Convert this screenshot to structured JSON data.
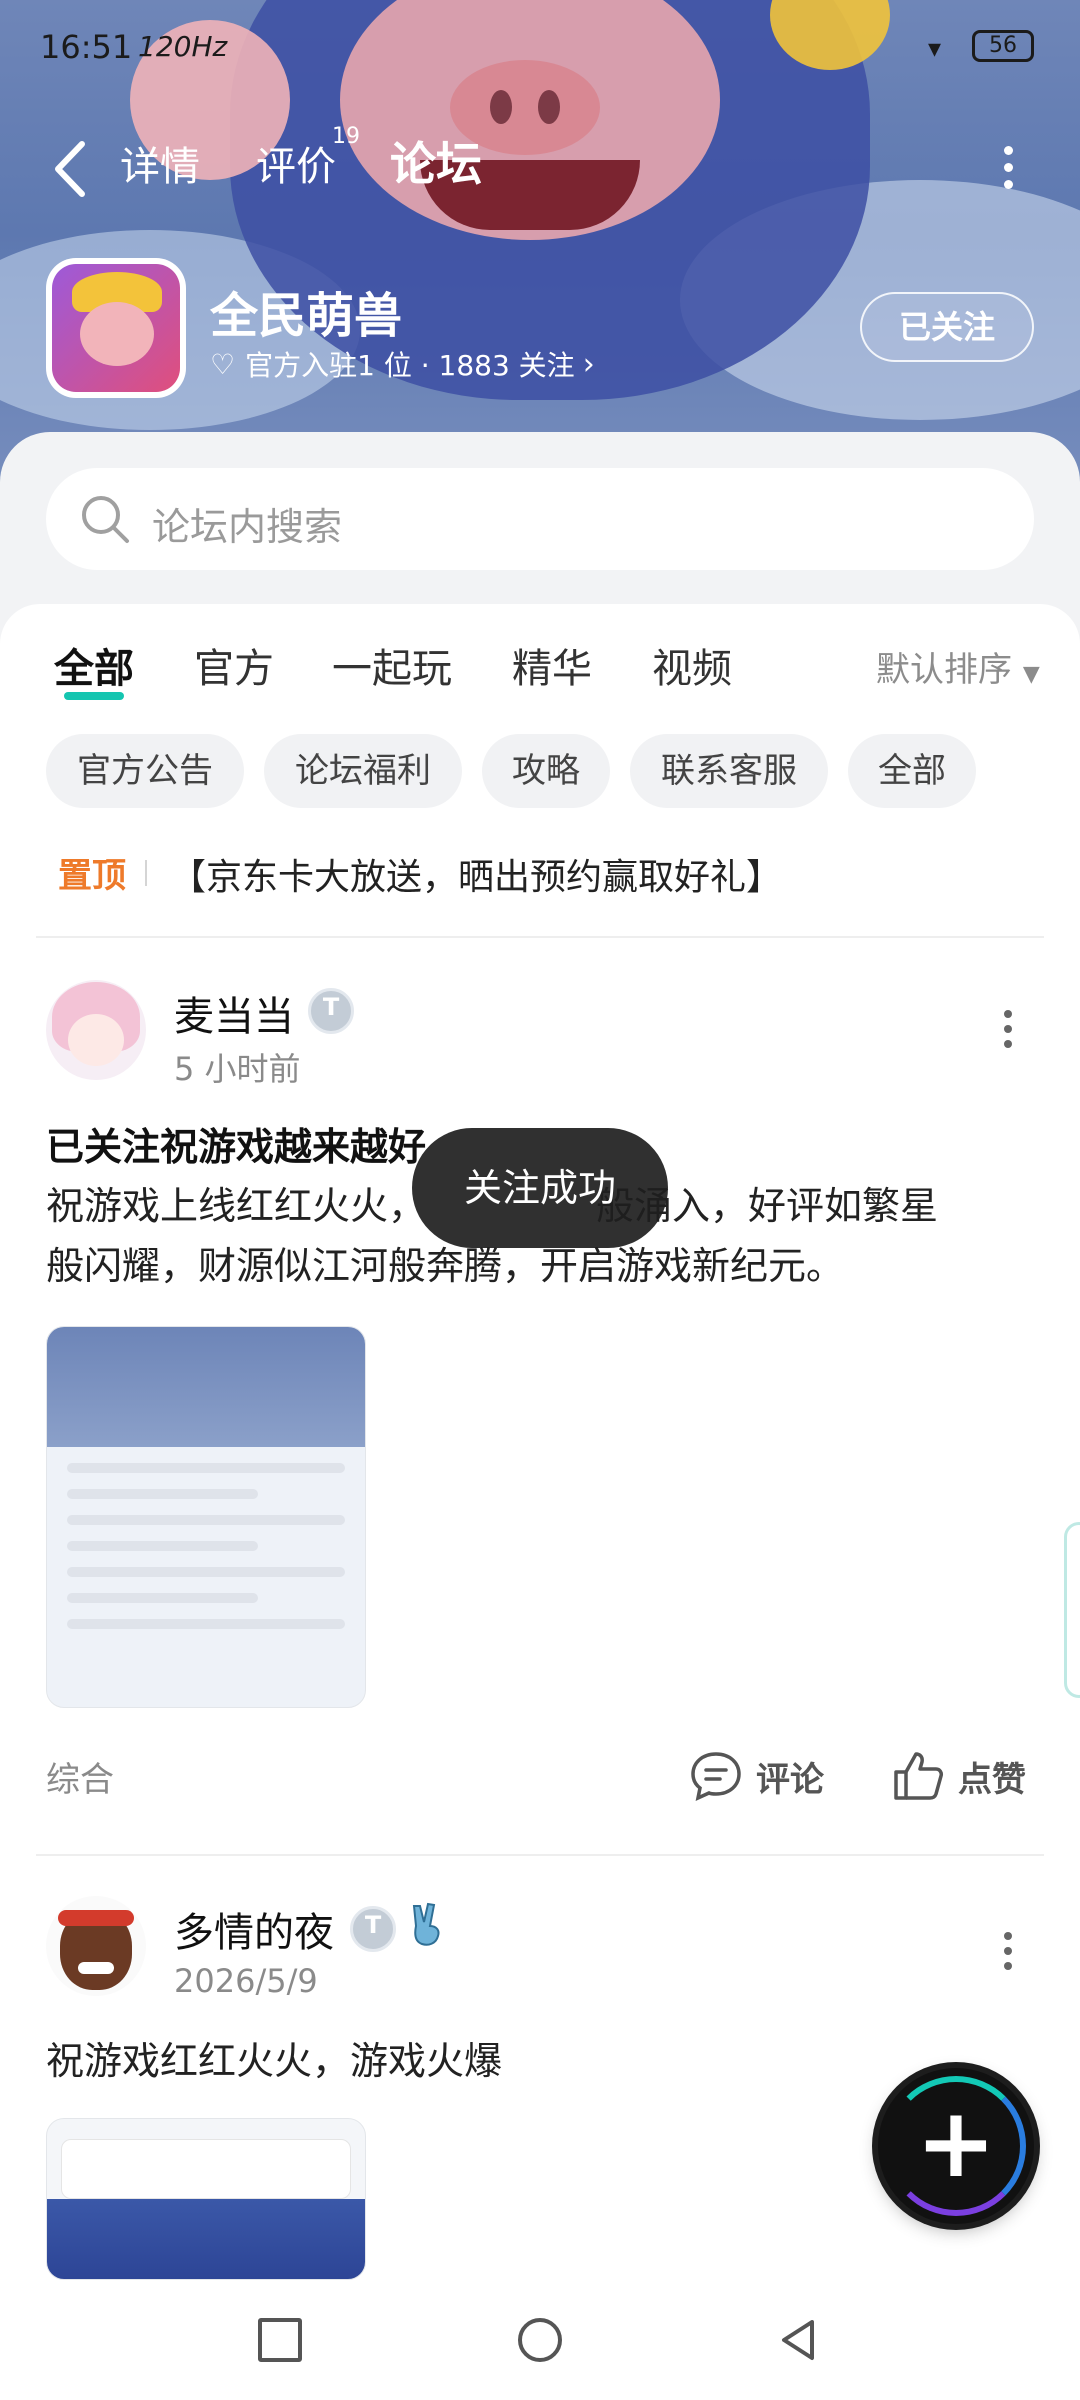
{
  "status_bar": {
    "time": "16:51",
    "refresh_rate": "120Hz",
    "battery": "56"
  },
  "nav": {
    "tabs": [
      {
        "label": "详情"
      },
      {
        "label": "评价",
        "count": "19"
      },
      {
        "label": "论坛"
      }
    ]
  },
  "app": {
    "name": "全民萌兽",
    "meta": "官方入驻1 位 · 1883 关注",
    "follow_label": "已关注"
  },
  "search": {
    "placeholder": "论坛内搜索"
  },
  "category_tabs": [
    "全部",
    "官方",
    "一起玩",
    "精华",
    "视频"
  ],
  "sort_label": "默认排序",
  "chips": [
    "官方公告",
    "论坛福利",
    "攻略",
    "联系客服",
    "全部"
  ],
  "pinned": {
    "label": "置顶",
    "text": "【京东卡大放送，晒出预约赢取好礼】"
  },
  "posts": [
    {
      "username": "麦当当",
      "time": "5 小时前",
      "title": "已关注祝游戏越来越好",
      "body_line1": "祝游戏上线红红火火，",
      "body_line1_end": "般涌入，好评如繁星",
      "body_line2": "般闪耀，财源似江河般奔腾，开启游戏新纪元。",
      "tag": "综合",
      "comment_label": "评论",
      "like_label": "点赞"
    },
    {
      "username": "多情的夜",
      "time": "2026/5/9",
      "body": "祝游戏红红火火，游戏火爆"
    }
  ],
  "toast": "关注成功",
  "colors": {
    "accent": "#14c5b0",
    "pinned": "#ee7a2a",
    "hero": "#5d78b0"
  }
}
